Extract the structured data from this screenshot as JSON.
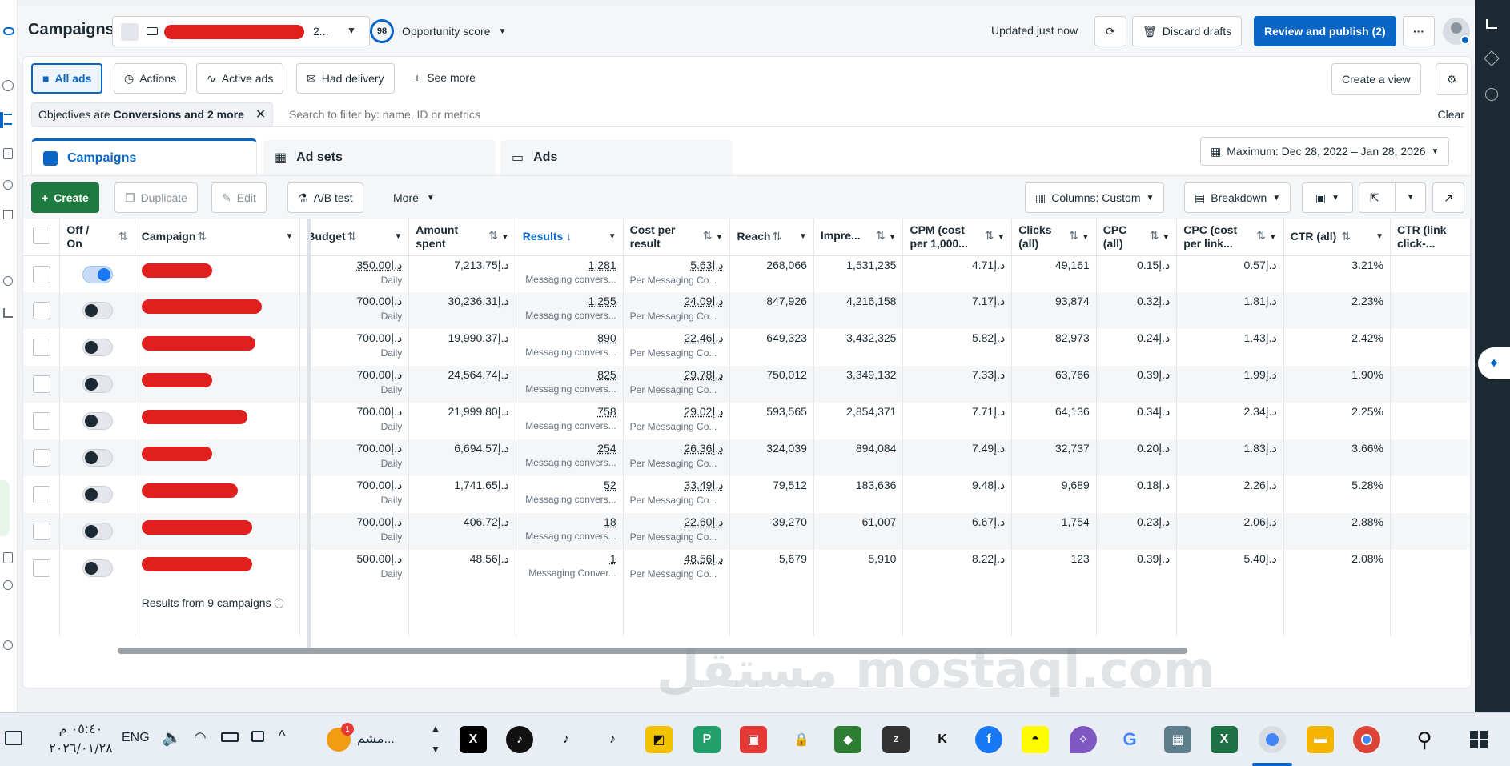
{
  "header": {
    "title": "Campaigns",
    "account_suffix": "2...",
    "opportunity_score": "98",
    "opportunity_label": "Opportunity score",
    "updated": "Updated just now",
    "discard": "Discard drafts",
    "publish": "Review and publish (2)",
    "more": "···"
  },
  "filters": {
    "all_ads": "All ads",
    "actions": "Actions",
    "active_ads": "Active ads",
    "had_delivery": "Had delivery",
    "see_more": "See more",
    "create_view": "Create a view",
    "chip_prefix": "Objectives are",
    "chip_value": "Conversions and 2 more",
    "search_placeholder": "Search to filter by: name, ID or metrics",
    "clear": "Clear"
  },
  "tabs": [
    {
      "label": "Campaigns"
    },
    {
      "label": "Ad sets"
    },
    {
      "label": "Ads"
    }
  ],
  "date_range": "Maximum: Dec 28, 2022 – Jan 28, 2026",
  "toolbar": {
    "create": "Create",
    "duplicate": "Duplicate",
    "edit": "Edit",
    "ab_test": "A/B test",
    "more": "More",
    "columns": "Columns: Custom",
    "breakdown": "Breakdown"
  },
  "columns": {
    "off_on": "Off / On",
    "campaign": "Campaign",
    "budget": "Budget",
    "amount_spent": "Amount spent",
    "results": "Results",
    "cost_per_result": "Cost per result",
    "reach": "Reach",
    "impressions": "Impre...",
    "cpm": "CPM (cost per 1,000...",
    "clicks": "Clicks (all)",
    "cpc": "CPC (all)",
    "cpc_link": "CPC (cost per link...",
    "ctr_all": "CTR (all)",
    "ctr_link": "CTR (link click-..."
  },
  "rows": [
    {
      "on": true,
      "budget": "د.إ350.00",
      "budget_sub": "Daily",
      "spent": "د.إ7,213.75",
      "results": "1,281",
      "results_sub": "Messaging convers...",
      "cpr": "د.إ5.63",
      "cpr_sub": "Per Messaging Co...",
      "reach": "268,066",
      "impr": "1,531,235",
      "cpm": "د.إ4.71",
      "clicks": "49,161",
      "cpc": "د.إ0.15",
      "cpc_link": "د.إ0.57",
      "ctr": "3.21%"
    },
    {
      "on": false,
      "budget": "د.إ700.00",
      "budget_sub": "Daily",
      "spent": "د.إ30,236.31",
      "results": "1,255",
      "results_sub": "Messaging convers...",
      "cpr": "د.إ24.09",
      "cpr_sub": "Per Messaging Co...",
      "reach": "847,926",
      "impr": "4,216,158",
      "cpm": "د.إ7.17",
      "clicks": "93,874",
      "cpc": "د.إ0.32",
      "cpc_link": "د.إ1.81",
      "ctr": "2.23%"
    },
    {
      "on": false,
      "budget": "د.إ700.00",
      "budget_sub": "Daily",
      "spent": "د.إ19,990.37",
      "results": "890",
      "results_sub": "Messaging convers...",
      "cpr": "د.إ22.46",
      "cpr_sub": "Per Messaging Co...",
      "reach": "649,323",
      "impr": "3,432,325",
      "cpm": "د.إ5.82",
      "clicks": "82,973",
      "cpc": "د.إ0.24",
      "cpc_link": "د.إ1.43",
      "ctr": "2.42%"
    },
    {
      "on": false,
      "budget": "د.إ700.00",
      "budget_sub": "Daily",
      "spent": "د.إ24,564.74",
      "results": "825",
      "results_sub": "Messaging convers...",
      "cpr": "د.إ29.78",
      "cpr_sub": "Per Messaging Co...",
      "reach": "750,012",
      "impr": "3,349,132",
      "cpm": "د.إ7.33",
      "clicks": "63,766",
      "cpc": "د.إ0.39",
      "cpc_link": "د.إ1.99",
      "ctr": "1.90%"
    },
    {
      "on": false,
      "budget": "د.إ700.00",
      "budget_sub": "Daily",
      "spent": "د.إ21,999.80",
      "results": "758",
      "results_sub": "Messaging convers...",
      "cpr": "د.إ29.02",
      "cpr_sub": "Per Messaging Co...",
      "reach": "593,565",
      "impr": "2,854,371",
      "cpm": "د.إ7.71",
      "clicks": "64,136",
      "cpc": "د.إ0.34",
      "cpc_link": "د.إ2.34",
      "ctr": "2.25%"
    },
    {
      "on": false,
      "budget": "د.إ700.00",
      "budget_sub": "Daily",
      "spent": "د.إ6,694.57",
      "results": "254",
      "results_sub": "Messaging convers...",
      "cpr": "د.إ26.36",
      "cpr_sub": "Per Messaging Co...",
      "reach": "324,039",
      "impr": "894,084",
      "cpm": "د.إ7.49",
      "clicks": "32,737",
      "cpc": "د.إ0.20",
      "cpc_link": "د.إ1.83",
      "ctr": "3.66%"
    },
    {
      "on": false,
      "budget": "د.إ700.00",
      "budget_sub": "Daily",
      "spent": "د.إ1,741.65",
      "results": "52",
      "results_sub": "Messaging convers...",
      "cpr": "د.إ33.49",
      "cpr_sub": "Per Messaging Co...",
      "reach": "79,512",
      "impr": "183,636",
      "cpm": "د.إ9.48",
      "clicks": "9,689",
      "cpc": "د.إ0.18",
      "cpc_link": "د.إ2.26",
      "ctr": "5.28%"
    },
    {
      "on": false,
      "budget": "د.إ700.00",
      "budget_sub": "Daily",
      "spent": "د.إ406.72",
      "results": "18",
      "results_sub": "Messaging convers...",
      "cpr": "د.إ22.60",
      "cpr_sub": "Per Messaging Co...",
      "reach": "39,270",
      "impr": "61,007",
      "cpm": "د.إ6.67",
      "clicks": "1,754",
      "cpc": "د.إ0.23",
      "cpc_link": "د.إ2.06",
      "ctr": "2.88%"
    },
    {
      "on": false,
      "budget": "د.إ500.00",
      "budget_sub": "Daily",
      "spent": "د.إ48.56",
      "results": "1",
      "results_sub": "Messaging Conver...",
      "cpr": "د.إ48.56",
      "cpr_sub": "Per Messaging Co...",
      "reach": "5,679",
      "impr": "5,910",
      "cpm": "د.إ8.22",
      "clicks": "123",
      "cpc": "د.إ0.39",
      "cpc_link": "د.إ5.40",
      "ctr": "2.08%"
    }
  ],
  "footer": {
    "results_from": "Results from 9 campaigns"
  },
  "taskbar": {
    "time": "٠٥:٤٠ م",
    "date": "٢٠٢٦/٠١/٢٨",
    "lang": "ENG",
    "app_label": "مشم...",
    "watermark": "مستقل mostaql.com"
  },
  "colors": {
    "primary": "#0866c6",
    "green": "#1f7a3f",
    "redaction": "#e0201e"
  }
}
